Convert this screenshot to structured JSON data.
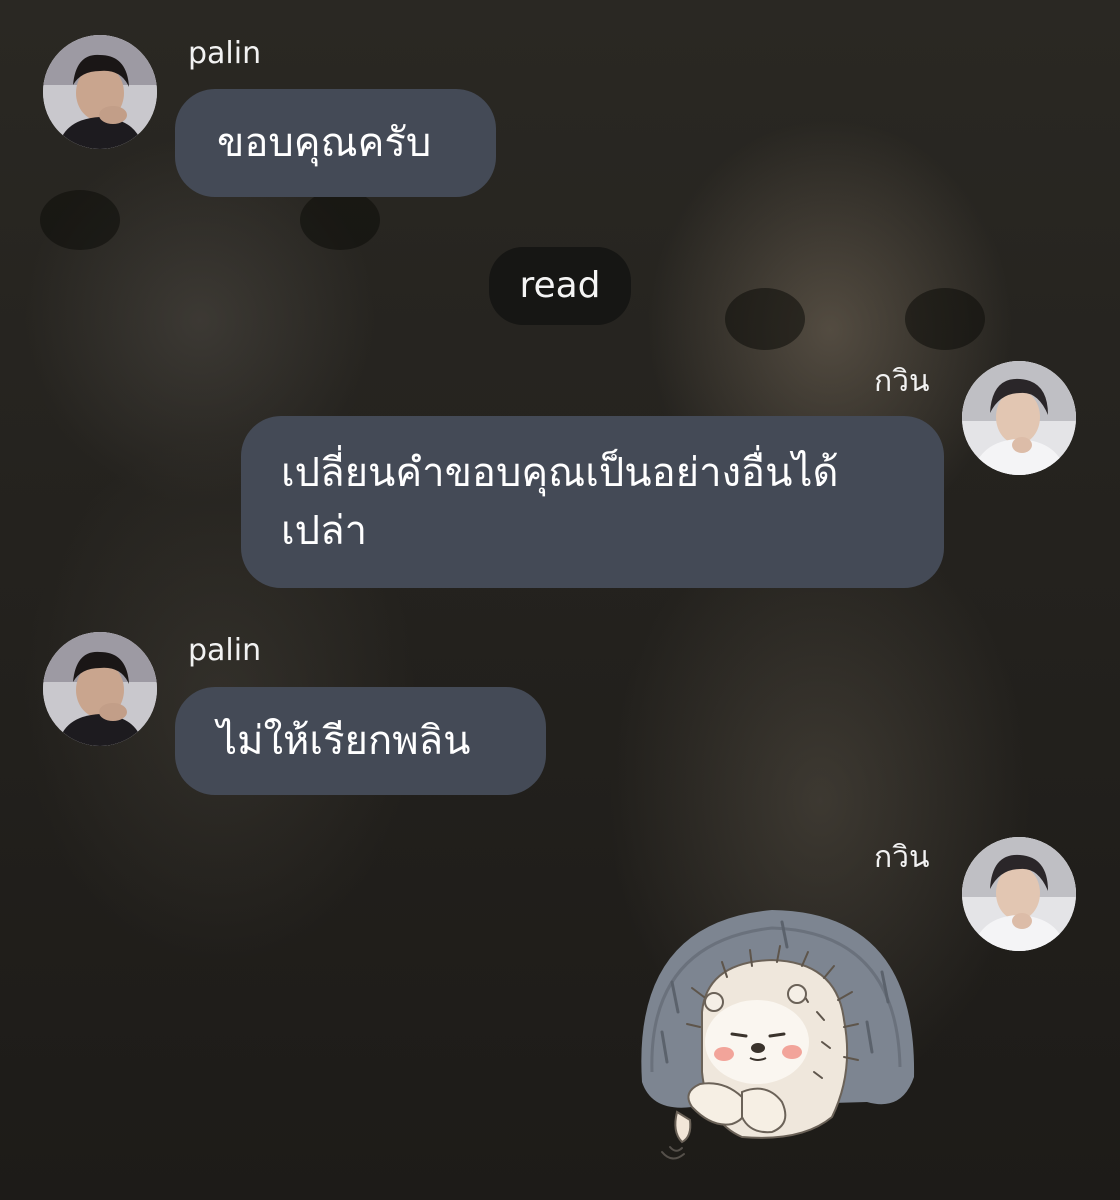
{
  "chat": {
    "messages": [
      {
        "sender": "palin",
        "text": "ขอบคุณครับ"
      },
      {
        "sender": "กวิน",
        "text": "เปลี่ยนคำขอบคุณเป็นอย่างอื่นได้เปล่า"
      },
      {
        "sender": "palin",
        "text": "ไม่ให้เรียกพลิน"
      },
      {
        "sender": "กวิน",
        "sticker": "hedgehog-sticker"
      }
    ],
    "read_label": "read"
  },
  "icons": {
    "palin_avatar": "palin-avatar",
    "kawin_avatar": "kawin-avatar",
    "sticker": "hedgehog-sticker"
  },
  "colors": {
    "bubble": "#444a56",
    "read_pill": "#161614",
    "name_text": "#f2f2f2"
  }
}
